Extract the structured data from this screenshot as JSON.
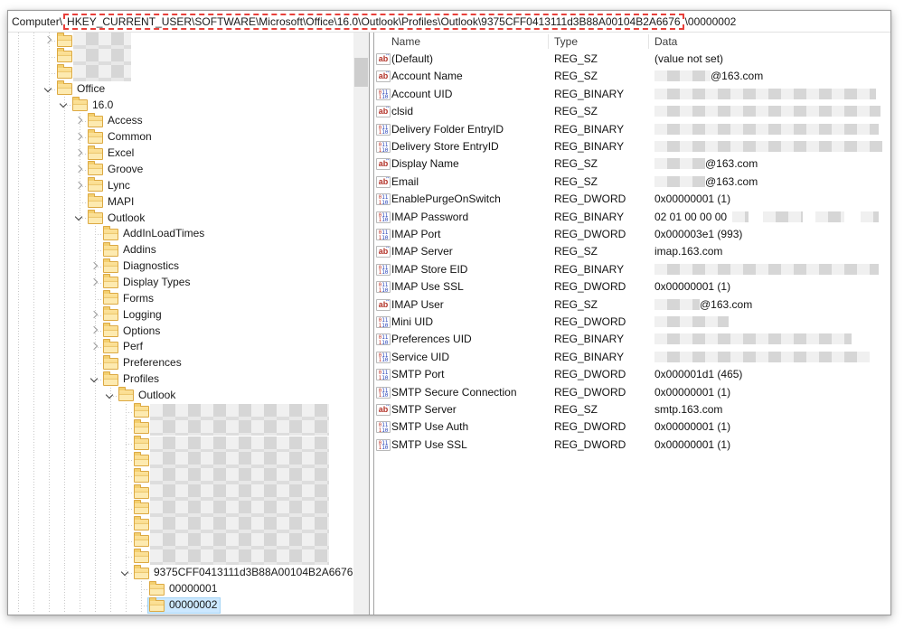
{
  "address": {
    "prefix": "Computer\\",
    "highlighted": "HKEY_CURRENT_USER\\SOFTWARE\\Microsoft\\Office\\16.0\\Outlook\\Profiles\\Outlook\\9375CFF0413111d3B88A00104B2A6676",
    "suffix": "\\00000002"
  },
  "colors": {
    "annotation_red": "#e8403a",
    "selection_blue": "#cce8ff",
    "folder_yellow": "#f7d478",
    "reg_sz_icon_red": "#b23127",
    "reg_bin_icon_blue": "#2743b8"
  },
  "tree": {
    "items": [
      {
        "label": "",
        "level": 3,
        "chevron": "closed",
        "blur": 64,
        "selected": false
      },
      {
        "label": "",
        "level": 3,
        "chevron": "none",
        "blur": 64,
        "selected": false
      },
      {
        "label": "",
        "level": 3,
        "chevron": "none",
        "blur": 64,
        "selected": false
      },
      {
        "label": "Office",
        "level": 3,
        "chevron": "open",
        "blur": 0,
        "selected": false
      },
      {
        "label": "16.0",
        "level": 4,
        "chevron": "open",
        "blur": 0,
        "selected": false
      },
      {
        "label": "Access",
        "level": 5,
        "chevron": "closed",
        "blur": 0,
        "selected": false
      },
      {
        "label": "Common",
        "level": 5,
        "chevron": "closed",
        "blur": 0,
        "selected": false
      },
      {
        "label": "Excel",
        "level": 5,
        "chevron": "closed",
        "blur": 0,
        "selected": false
      },
      {
        "label": "Groove",
        "level": 5,
        "chevron": "closed",
        "blur": 0,
        "selected": false
      },
      {
        "label": "Lync",
        "level": 5,
        "chevron": "closed",
        "blur": 0,
        "selected": false
      },
      {
        "label": "MAPI",
        "level": 5,
        "chevron": "none",
        "blur": 0,
        "selected": false
      },
      {
        "label": "Outlook",
        "level": 5,
        "chevron": "open",
        "blur": 0,
        "selected": false
      },
      {
        "label": "AddInLoadTimes",
        "level": 6,
        "chevron": "none",
        "blur": 0,
        "selected": false
      },
      {
        "label": "Addins",
        "level": 6,
        "chevron": "none",
        "blur": 0,
        "selected": false
      },
      {
        "label": "Diagnostics",
        "level": 6,
        "chevron": "closed",
        "blur": 0,
        "selected": false
      },
      {
        "label": "Display Types",
        "level": 6,
        "chevron": "closed",
        "blur": 0,
        "selected": false
      },
      {
        "label": "Forms",
        "level": 6,
        "chevron": "none",
        "blur": 0,
        "selected": false
      },
      {
        "label": "Logging",
        "level": 6,
        "chevron": "closed",
        "blur": 0,
        "selected": false
      },
      {
        "label": "Options",
        "level": 6,
        "chevron": "closed",
        "blur": 0,
        "selected": false
      },
      {
        "label": "Perf",
        "level": 6,
        "chevron": "closed",
        "blur": 0,
        "selected": false
      },
      {
        "label": "Preferences",
        "level": 6,
        "chevron": "none",
        "blur": 0,
        "selected": false
      },
      {
        "label": "Profiles",
        "level": 6,
        "chevron": "open",
        "blur": 0,
        "selected": false
      },
      {
        "label": "Outlook",
        "level": 7,
        "chevron": "open",
        "blur": 0,
        "selected": false
      },
      {
        "label": "",
        "level": 8,
        "chevron": "none",
        "blur": 198,
        "selected": false
      },
      {
        "label": "",
        "level": 8,
        "chevron": "none",
        "blur": 198,
        "selected": false
      },
      {
        "label": "",
        "level": 8,
        "chevron": "none",
        "blur": 198,
        "selected": false
      },
      {
        "label": "",
        "level": 8,
        "chevron": "none",
        "blur": 198,
        "selected": false
      },
      {
        "label": "",
        "level": 8,
        "chevron": "none",
        "blur": 198,
        "selected": false
      },
      {
        "label": "",
        "level": 8,
        "chevron": "none",
        "blur": 198,
        "selected": false
      },
      {
        "label": "",
        "level": 8,
        "chevron": "none",
        "blur": 198,
        "selected": false
      },
      {
        "label": "",
        "level": 8,
        "chevron": "none",
        "blur": 198,
        "selected": false
      },
      {
        "label": "",
        "level": 8,
        "chevron": "none",
        "blur": 198,
        "selected": false
      },
      {
        "label": "",
        "level": 8,
        "chevron": "none",
        "blur": 198,
        "selected": false
      },
      {
        "label": "9375CFF0413111d3B88A00104B2A6676",
        "level": 8,
        "chevron": "open",
        "blur": 0,
        "selected": false
      },
      {
        "label": "00000001",
        "level": 9,
        "chevron": "none",
        "blur": 0,
        "selected": false
      },
      {
        "label": "00000002",
        "level": 9,
        "chevron": "none",
        "blur": 0,
        "selected": true
      }
    ]
  },
  "list": {
    "columns": [
      "Name",
      "Type",
      "Data"
    ],
    "rows": [
      {
        "icon": "sz",
        "name": "(Default)",
        "type": "REG_SZ",
        "data": [
          {
            "text": "(value not set)"
          }
        ]
      },
      {
        "icon": "sz",
        "name": "Account Name",
        "type": "REG_SZ",
        "data": [
          {
            "blur": 62
          },
          {
            "text": "@163.com"
          }
        ]
      },
      {
        "icon": "bin",
        "name": "Account UID",
        "type": "REG_BINARY",
        "data": [
          {
            "blur": 245
          }
        ]
      },
      {
        "icon": "sz",
        "name": "clsid",
        "type": "REG_SZ",
        "data": [
          {
            "blur": 250
          }
        ]
      },
      {
        "icon": "bin",
        "name": "Delivery Folder EntryID",
        "type": "REG_BINARY",
        "data": [
          {
            "blur": 248
          }
        ]
      },
      {
        "icon": "bin",
        "name": "Delivery Store EntryID",
        "type": "REG_BINARY",
        "data": [
          {
            "blur": 252
          }
        ]
      },
      {
        "icon": "sz",
        "name": "Display Name",
        "type": "REG_SZ",
        "data": [
          {
            "blur": 56
          },
          {
            "text": "@163.com"
          }
        ]
      },
      {
        "icon": "sz",
        "name": "Email",
        "type": "REG_SZ",
        "data": [
          {
            "blur": 56
          },
          {
            "text": "@163.com"
          }
        ]
      },
      {
        "icon": "bin",
        "name": "EnablePurgeOnSwitch",
        "type": "REG_DWORD",
        "data": [
          {
            "text": "0x00000001 (1)"
          }
        ]
      },
      {
        "icon": "bin",
        "name": "IMAP Password",
        "type": "REG_BINARY",
        "data": [
          {
            "text": "02 01 00 00 00"
          },
          {
            "blur": 18,
            "gap": 6
          },
          {
            "blur": 44,
            "gap": 16
          },
          {
            "blur": 32,
            "gap": 14
          },
          {
            "blur": 20,
            "gap": 18
          }
        ]
      },
      {
        "icon": "bin",
        "name": "IMAP Port",
        "type": "REG_DWORD",
        "data": [
          {
            "text": "0x000003e1 (993)"
          }
        ]
      },
      {
        "icon": "sz",
        "name": "IMAP Server",
        "type": "REG_SZ",
        "data": [
          {
            "text": "imap.163.com"
          }
        ]
      },
      {
        "icon": "bin",
        "name": "IMAP Store EID",
        "type": "REG_BINARY",
        "data": [
          {
            "blur": 248
          }
        ]
      },
      {
        "icon": "bin",
        "name": "IMAP Use SSL",
        "type": "REG_DWORD",
        "data": [
          {
            "text": "0x00000001 (1)"
          }
        ]
      },
      {
        "icon": "sz",
        "name": "IMAP User",
        "type": "REG_SZ",
        "data": [
          {
            "blur": 50
          },
          {
            "text": "@163.com"
          }
        ]
      },
      {
        "icon": "bin",
        "name": "Mini UID",
        "type": "REG_DWORD",
        "data": [
          {
            "blur": 82
          }
        ]
      },
      {
        "icon": "bin",
        "name": "Preferences UID",
        "type": "REG_BINARY",
        "data": [
          {
            "blur": 218
          }
        ]
      },
      {
        "icon": "bin",
        "name": "Service UID",
        "type": "REG_BINARY",
        "data": [
          {
            "blur": 238
          }
        ]
      },
      {
        "icon": "bin",
        "name": "SMTP Port",
        "type": "REG_DWORD",
        "data": [
          {
            "text": "0x000001d1 (465)"
          }
        ]
      },
      {
        "icon": "bin",
        "name": "SMTP Secure Connection",
        "type": "REG_DWORD",
        "data": [
          {
            "text": "0x00000001 (1)"
          }
        ]
      },
      {
        "icon": "sz",
        "name": "SMTP Server",
        "type": "REG_SZ",
        "data": [
          {
            "text": "smtp.163.com"
          }
        ]
      },
      {
        "icon": "bin",
        "name": "SMTP Use Auth",
        "type": "REG_DWORD",
        "data": [
          {
            "text": "0x00000001 (1)"
          }
        ]
      },
      {
        "icon": "bin",
        "name": "SMTP Use SSL",
        "type": "REG_DWORD",
        "data": [
          {
            "text": "0x00000001 (1)"
          }
        ]
      }
    ]
  }
}
